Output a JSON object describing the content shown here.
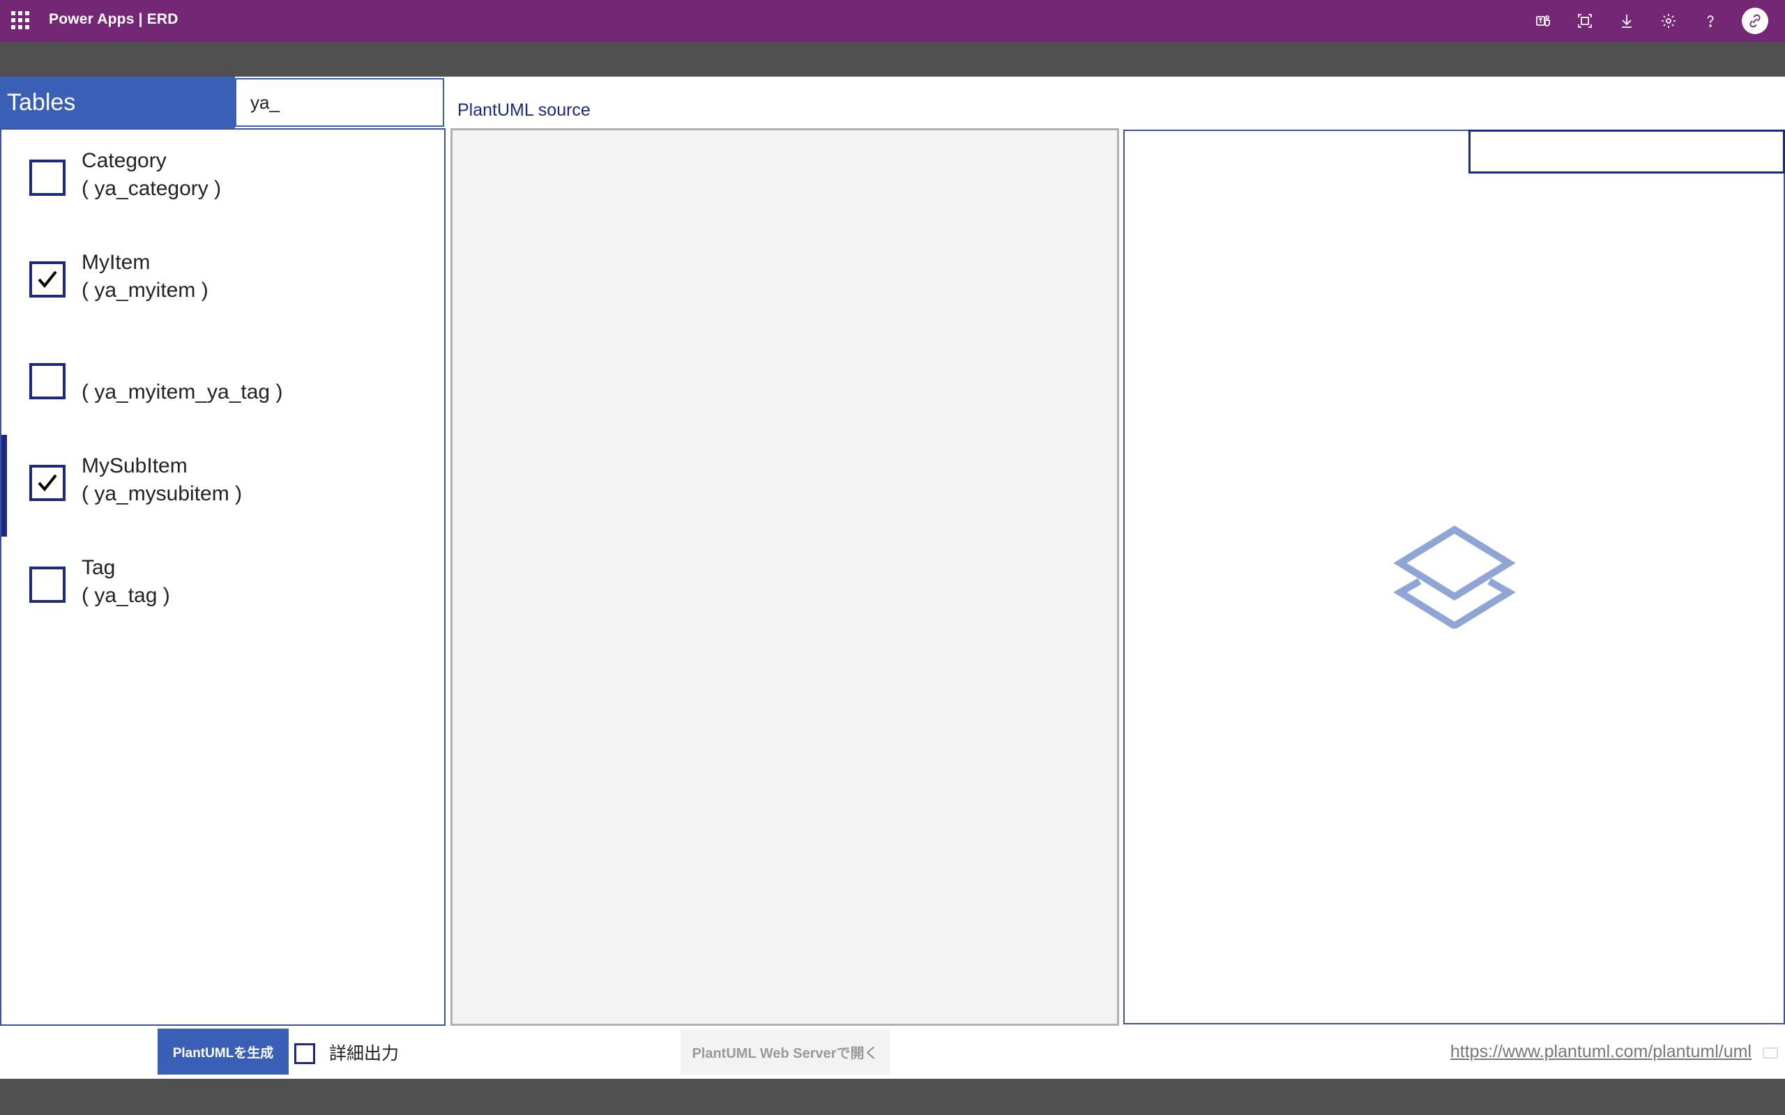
{
  "topbar": {
    "title": "Power Apps  |  ERD",
    "tools": [
      "teams-icon",
      "fit-screen-icon",
      "download-icon",
      "settings-icon",
      "help-icon",
      "avatar"
    ],
    "color": "#742774"
  },
  "sidebar": {
    "header": "Tables",
    "search_value": "ya_",
    "items": [
      {
        "display": "Category",
        "logical": "( ya_category )",
        "checked": false,
        "selected": false
      },
      {
        "display": "MyItem",
        "logical": "( ya_myitem )",
        "checked": true,
        "selected": false
      },
      {
        "display": "",
        "logical": "( ya_myitem_ya_tag )",
        "checked": false,
        "selected": false
      },
      {
        "display": "MySubItem",
        "logical": "( ya_mysubitem )",
        "checked": true,
        "selected": true
      },
      {
        "display": "Tag",
        "logical": "( ya_tag )",
        "checked": false,
        "selected": false
      }
    ]
  },
  "main": {
    "source_label": "PlantUML source",
    "source_value": "",
    "preview_input_value": ""
  },
  "footer": {
    "generate_label": "PlantUMLを生成",
    "detail_label": "詳細出力",
    "detail_checked": false,
    "open_label": "PlantUML Web Serverで開く",
    "url": "https://www.plantuml.com/plantuml/uml"
  }
}
